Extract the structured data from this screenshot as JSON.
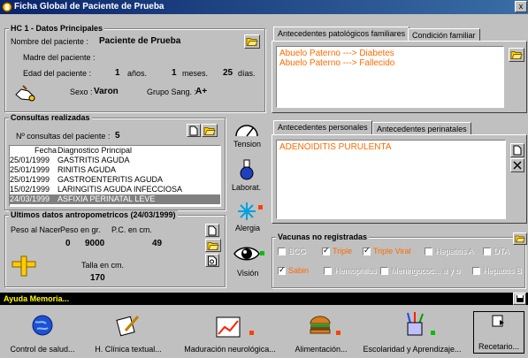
{
  "window": {
    "title": "Ficha Global de Paciente de Prueba",
    "close": "x"
  },
  "hc": {
    "title": "HC 1 - Datos Principales",
    "name_label": "Nombre del paciente :",
    "name_value": "Paciente de Prueba",
    "mother_label": "Madre del paciente :",
    "age_label": "Edad del paciente :",
    "age_years": "1",
    "years_label": "años.",
    "age_months": "1",
    "months_label": "meses.",
    "age_days": "25",
    "days_label": "días.",
    "sex_label": "Sexo :",
    "sex_value": "Varon",
    "blood_label": "Grupo Sang. :",
    "blood_value": "A+"
  },
  "consultas": {
    "title": "Consultas realizadas",
    "count_label": "Nº consultas del paciente :",
    "count_value": "5",
    "col_fecha": "Fecha",
    "col_diag": "Diagnostico Principal",
    "rows": [
      {
        "fecha": "25/01/1999",
        "diag": "GASTRITIS AGUDA"
      },
      {
        "fecha": "25/01/1999",
        "diag": "RINITIS AGUDA"
      },
      {
        "fecha": "25/01/1999",
        "diag": "GASTROENTERITIS AGUDA"
      },
      {
        "fecha": "15/02/1999",
        "diag": "LARINGITIS AGUDA INFECCIOSA"
      },
      {
        "fecha": "24/03/1999",
        "diag": "ASFIXIA PERINATAL LEVE"
      }
    ],
    "selected_index": 4
  },
  "antropo": {
    "title": "Ultimos datos antropometricos (24/03/1999)",
    "peso_nacer_label": "Peso al Nacer",
    "peso_label": "Peso en gr.",
    "pc_label": "P.C. en cm.",
    "peso_nacer": "0",
    "peso": "9000",
    "pc": "49",
    "talla_label": "Talla en cm.",
    "talla": "170"
  },
  "side": {
    "tension": "Tension",
    "laborat": "Laborat.",
    "alergia": "Alergia",
    "vision": "Visión"
  },
  "familiares": {
    "tab1": "Antecedentes patológicos familiares",
    "tab2": "Condición familiar",
    "lines": [
      "Abuelo Paterno ---> Diabetes",
      "Abuelo Paterno ---> Fallecido"
    ]
  },
  "personales": {
    "tab1": "Antecedentes personales",
    "tab2": "Antecedentes perinatales",
    "lines": [
      "ADENOIDITIS PURULENTA"
    ]
  },
  "vacunas": {
    "title": "Vacunas no registradas",
    "row1": [
      {
        "label": "BCG",
        "checked": false,
        "state": "disabled"
      },
      {
        "label": "Triple",
        "checked": true,
        "state": "active"
      },
      {
        "label": "Triple Viral",
        "checked": true,
        "state": "active"
      },
      {
        "label": "Hepatitis A",
        "checked": false,
        "state": "disabled"
      },
      {
        "label": "DTA",
        "checked": false,
        "state": "disabled"
      }
    ],
    "row2": [
      {
        "label": "Sabin",
        "checked": true,
        "state": "active"
      },
      {
        "label": "Hemophilus",
        "checked": false,
        "state": "disabled"
      },
      {
        "label": "Meningococ... a y b",
        "checked": false,
        "state": "disabled"
      },
      {
        "label": "Hepatitis B",
        "checked": false,
        "state": "disabled"
      }
    ]
  },
  "ayuda": {
    "label": "Ayuda Memoria..."
  },
  "toolbar": [
    {
      "label": "Control de salud..."
    },
    {
      "label": "H. Clínica textual..."
    },
    {
      "label": "Maduración neurológica..."
    },
    {
      "label": "Alimentación..."
    },
    {
      "label": "Escolaridad y Aprendizaje..."
    },
    {
      "label": "Recetario..."
    }
  ],
  "colors": {
    "accent_text": "#ff6a00",
    "title_bar": "#0a246a",
    "selection": "#808080"
  }
}
